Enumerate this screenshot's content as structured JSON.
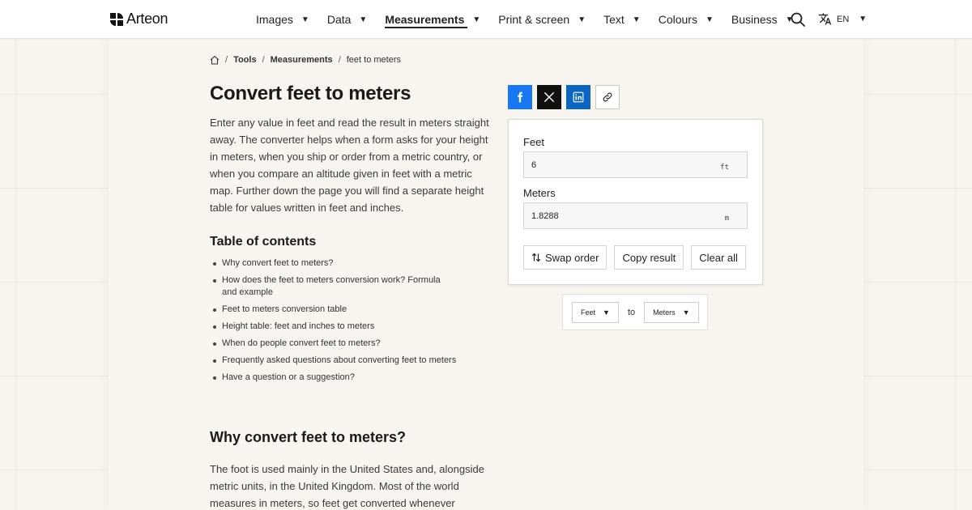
{
  "header": {
    "brand": "Arteon",
    "nav": [
      {
        "label": "Images",
        "active": false
      },
      {
        "label": "Data",
        "active": false
      },
      {
        "label": "Measurements",
        "active": true
      },
      {
        "label": "Print & screen",
        "active": false
      },
      {
        "label": "Text",
        "active": false
      },
      {
        "label": "Colours",
        "active": false
      },
      {
        "label": "Business",
        "active": false
      }
    ],
    "language": "EN"
  },
  "breadcrumb": {
    "items": [
      "Tools",
      "Measurements"
    ],
    "current": "feet to meters"
  },
  "page": {
    "title": "Convert feet to meters",
    "intro": "Enter any value in feet and read the result in meters straight away. The converter helps when a form asks for your height in meters, when you ship or order from a metric country, or when you compare an altitude given in feet with a metric map. Further down the page you will find a separate height table for values written in feet and inches.",
    "toc_heading": "Table of contents",
    "toc": [
      "Why convert feet to meters?",
      "How does the feet to meters conversion work? Formula and example",
      "Feet to meters conversion table",
      "Height table: feet and inches to meters",
      "When do people convert feet to meters?",
      "Frequently asked questions about converting feet to meters",
      "Have a question or a suggestion?"
    ],
    "section_heading": "Why convert feet to meters?",
    "section_text": "The foot is used mainly in the United States and, alongside metric units, in the United Kingdom. Most of the world measures in meters, so feet get converted whenever"
  },
  "converter": {
    "from_label": "Feet",
    "from_value": "6",
    "from_unit": "ft",
    "to_label": "Meters",
    "to_value": "1.8288",
    "to_unit": "m",
    "swap_label": "Swap order",
    "copy_label": "Copy result",
    "clear_label": "Clear all"
  },
  "unit_picker": {
    "from": "Feet",
    "to_word": "to",
    "to": "Meters"
  },
  "colors": {
    "facebook": "#1877f2",
    "x": "#111111",
    "linkedin": "#0a66c2",
    "background": "#f8f5f1"
  }
}
